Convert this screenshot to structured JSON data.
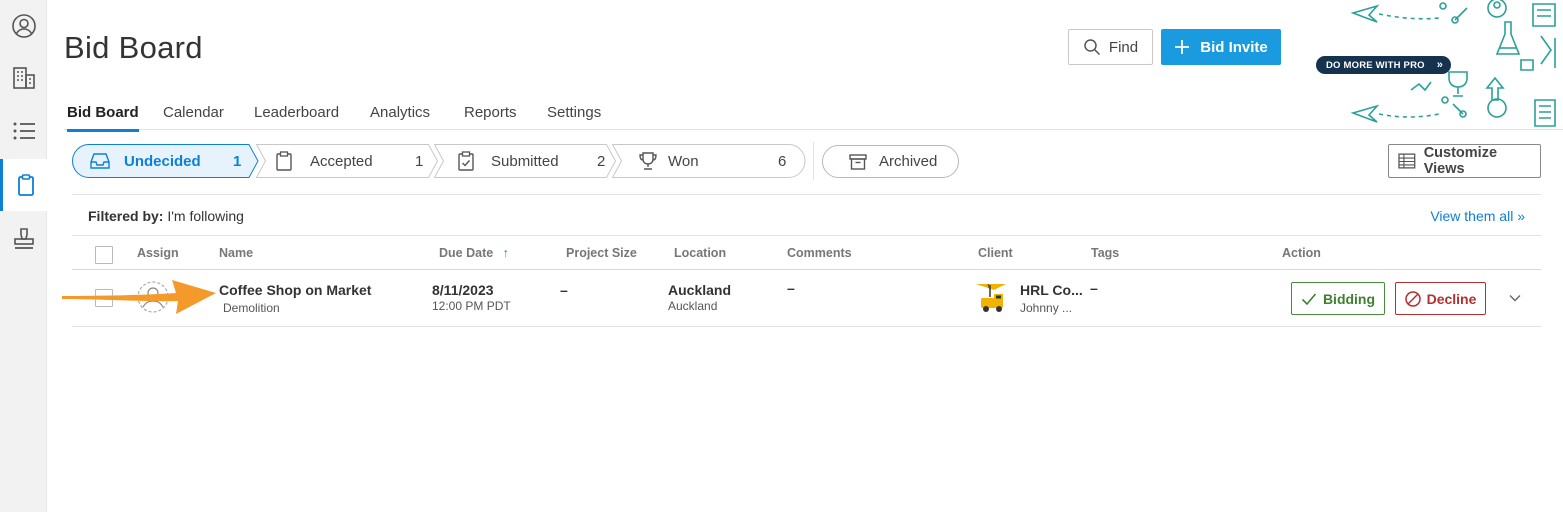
{
  "header": {
    "title": "Bid Board",
    "find_label": "Find",
    "invite_label": "Bid Invite",
    "pro_label": "DO MORE WITH PRO"
  },
  "nav": {
    "rail": [
      "account-icon",
      "building-icon",
      "list-icon",
      "clipboard-icon",
      "stamp-icon"
    ],
    "active_rail": "clipboard-icon"
  },
  "tabs": [
    {
      "label": "Bid Board",
      "active": true
    },
    {
      "label": "Calendar"
    },
    {
      "label": "Leaderboard"
    },
    {
      "label": "Analytics"
    },
    {
      "label": "Reports"
    },
    {
      "label": "Settings"
    }
  ],
  "pipeline": [
    {
      "label": "Undecided",
      "count": "1",
      "icon": "inbox-icon",
      "active": true
    },
    {
      "label": "Accepted",
      "count": "1",
      "icon": "clipboard-icon"
    },
    {
      "label": "Submitted",
      "count": "2",
      "icon": "clipboard-check-icon"
    },
    {
      "label": "Won",
      "count": "6",
      "icon": "trophy-icon"
    }
  ],
  "archived_label": "Archived",
  "customize_label": "Customize Views",
  "filter": {
    "prefix": "Filtered by:",
    "value": "I'm following",
    "link": "View them all »"
  },
  "table": {
    "columns": [
      "Assign",
      "Name",
      "Due Date",
      "Project Size",
      "Location",
      "Comments",
      "Client",
      "Tags",
      "Action"
    ],
    "sort_indicator": "↑",
    "rows": [
      {
        "name": "Coffee Shop on Market",
        "trade": "Demolition",
        "due_date": "8/11/2023",
        "due_time": "12:00 PM PDT",
        "project_size": "–",
        "location_city": "Auckland",
        "location_region": "Auckland",
        "comments": "–",
        "client_name": "HRL Co...",
        "client_contact": "Johnny ...",
        "tags": "–",
        "bidding_label": "Bidding",
        "decline_label": "Decline"
      }
    ]
  },
  "colors": {
    "accent": "#0e7fd6",
    "invite_bg": "#1a9be0",
    "bidding": "#3f7f30",
    "decline": "#b33030",
    "annotation_arrow": "#f39a2b"
  }
}
